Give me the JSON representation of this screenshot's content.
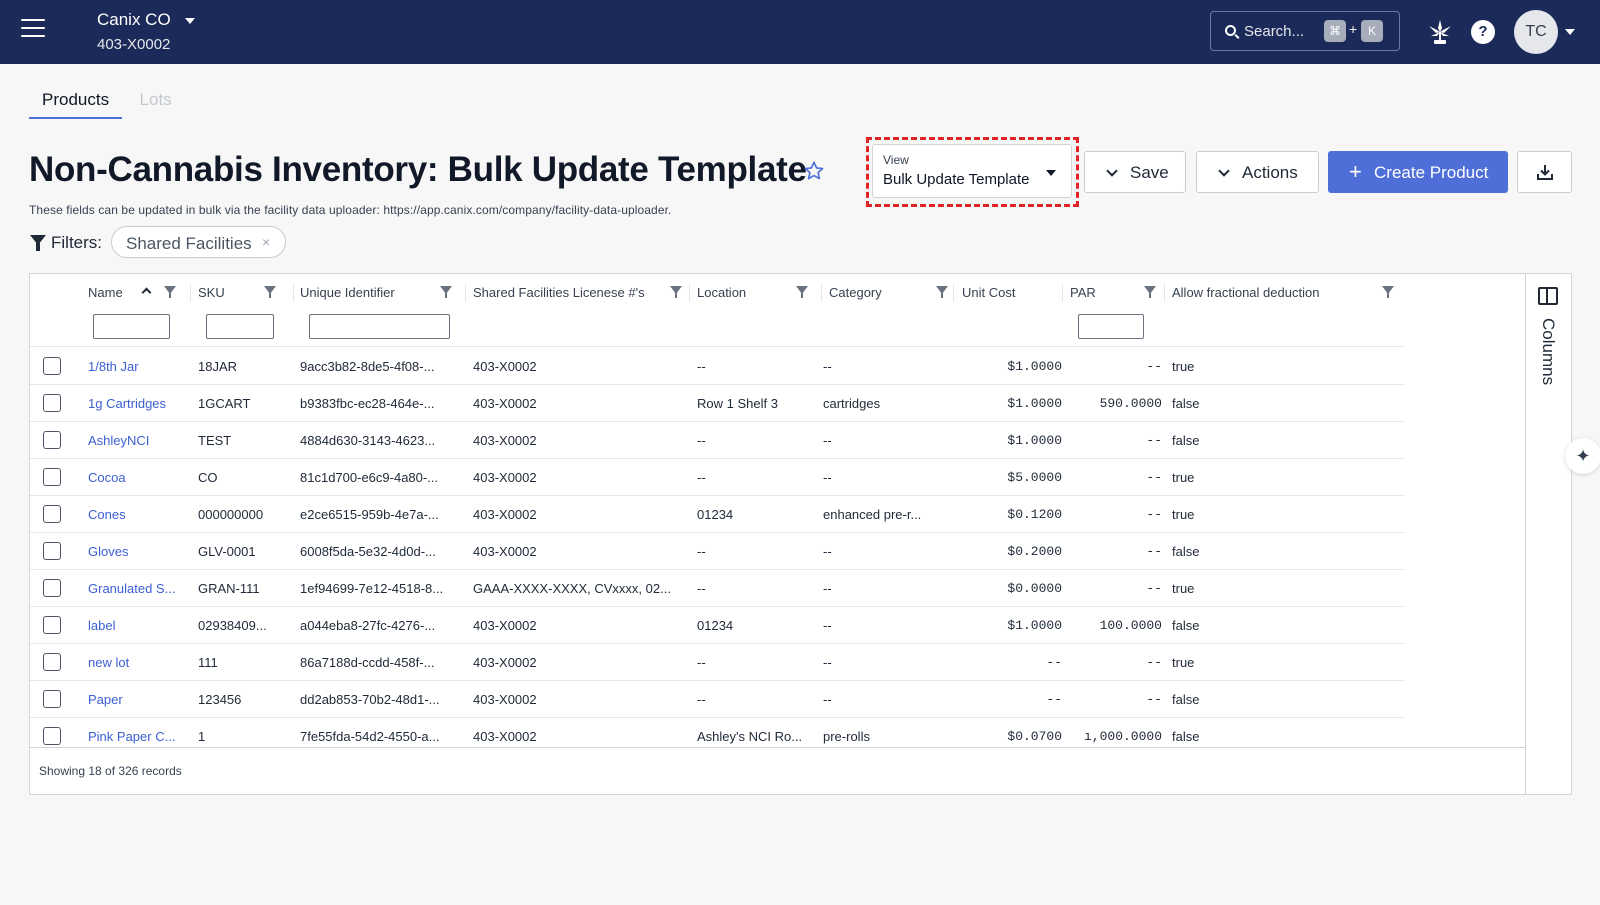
{
  "header": {
    "company_name": "Canix CO",
    "company_id": "403-X0002",
    "search_placeholder": "Search...",
    "shortcut_cmd": "⌘",
    "shortcut_plus": "+",
    "shortcut_key": "K",
    "help_label": "?",
    "avatar_initials": "TC"
  },
  "tabs": [
    {
      "label": "Products",
      "active": true
    },
    {
      "label": "Lots",
      "active": false
    }
  ],
  "page": {
    "title": "Non-Cannabis Inventory: Bulk Update Template",
    "subtitle": "These fields can be updated in bulk via the facility data uploader: https://app.canix.com/company/facility-data-uploader."
  },
  "view_select": {
    "label": "View",
    "value": "Bulk Update Template"
  },
  "toolbar": {
    "save_label": "Save",
    "actions_label": "Actions",
    "create_label": "Create Product"
  },
  "filters": {
    "label": "Filters:",
    "chips": [
      "Shared Facilities"
    ]
  },
  "columns": [
    "Name",
    "SKU",
    "Unique Identifier",
    "Shared Facilities Licenese #'s",
    "Location",
    "Category",
    "Unit Cost",
    "PAR",
    "Allow fractional deduction"
  ],
  "rows": [
    {
      "name": "1/8th Jar",
      "sku": "18JAR",
      "uid": "9acc3b82-8de5-4f08-...",
      "license": "403-X0002",
      "location": "--",
      "category": "--",
      "unit_cost": "$1.0000",
      "par": "--",
      "fractional": "true"
    },
    {
      "name": "1g Cartridges",
      "sku": "1GCART",
      "uid": "b9383fbc-ec28-464e-...",
      "license": "403-X0002",
      "location": "Row 1 Shelf 3",
      "category": "cartridges",
      "unit_cost": "$1.0000",
      "par": "590.0000",
      "fractional": "false"
    },
    {
      "name": "AshleyNCI",
      "sku": "TEST",
      "uid": "4884d630-3143-4623...",
      "license": "403-X0002",
      "location": "--",
      "category": "--",
      "unit_cost": "$1.0000",
      "par": "--",
      "fractional": "false"
    },
    {
      "name": "Cocoa",
      "sku": "CO",
      "uid": "81c1d700-e6c9-4a80-...",
      "license": "403-X0002",
      "location": "--",
      "category": "--",
      "unit_cost": "$5.0000",
      "par": "--",
      "fractional": "true"
    },
    {
      "name": "Cones",
      "sku": "000000000",
      "uid": "e2ce6515-959b-4e7a-...",
      "license": "403-X0002",
      "location": "01234",
      "category": "enhanced pre-r...",
      "unit_cost": "$0.1200",
      "par": "--",
      "fractional": "true"
    },
    {
      "name": "Gloves",
      "sku": "GLV-0001",
      "uid": "6008f5da-5e32-4d0d-...",
      "license": "403-X0002",
      "location": "--",
      "category": "--",
      "unit_cost": "$0.2000",
      "par": "--",
      "fractional": "false"
    },
    {
      "name": "Granulated S...",
      "sku": "GRAN-111",
      "uid": "1ef94699-7e12-4518-8...",
      "license": "GAAA-XXXX-XXXX, CVxxxx, 02...",
      "location": "--",
      "category": "--",
      "unit_cost": "$0.0000",
      "par": "--",
      "fractional": "true"
    },
    {
      "name": "label",
      "sku": "02938409...",
      "uid": "a044eba8-27fc-4276-...",
      "license": "403-X0002",
      "location": "01234",
      "category": "--",
      "unit_cost": "$1.0000",
      "par": "100.0000",
      "fractional": "false"
    },
    {
      "name": "new lot",
      "sku": "111",
      "uid": "86a7188d-ccdd-458f-...",
      "license": "403-X0002",
      "location": "--",
      "category": "--",
      "unit_cost": "--",
      "par": "--",
      "fractional": "true"
    },
    {
      "name": "Paper",
      "sku": "123456",
      "uid": "dd2ab853-70b2-48d1-...",
      "license": "403-X0002",
      "location": "--",
      "category": "--",
      "unit_cost": "--",
      "par": "--",
      "fractional": "false"
    },
    {
      "name": "Pink Paper C...",
      "sku": "1",
      "uid": "7fe55fda-54d2-4550-a...",
      "license": "403-X0002",
      "location": "Ashley's NCI Ro...",
      "category": "pre-rolls",
      "unit_cost": "$0.0700",
      "par": "ı,000.0000",
      "fractional": "false"
    }
  ],
  "column_panel_label": "Columns",
  "footer": {
    "records_text": "Showing 18 of 326 records"
  },
  "colors": {
    "header_bg": "#1c2a59",
    "accent": "#4f6fd8",
    "link": "#3b5fd4",
    "highlight": "#e02424"
  }
}
